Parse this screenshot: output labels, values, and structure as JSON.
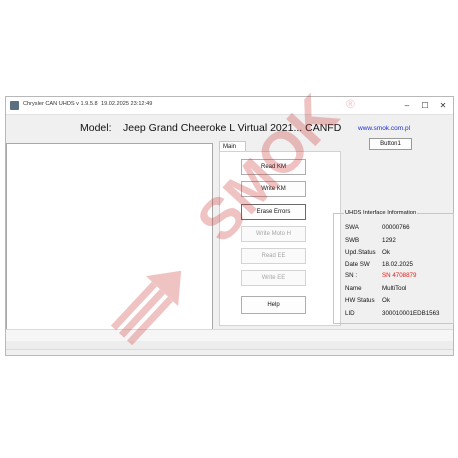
{
  "window": {
    "title": "Chrysler CAN UHDS v 1.9.5.8",
    "timestamp": "19.02.2025 23:12:49",
    "controls": [
      "–",
      "☐",
      "✕"
    ]
  },
  "header": {
    "model_label": "Model:",
    "model_value": "Jeep Grand Cheeroke L Virtual 2021... CANFD",
    "website": "www.smok.com.pl",
    "button1_label": "Button1"
  },
  "tabs": [
    {
      "label": "Main"
    }
  ],
  "buttons": [
    {
      "label": "Read KM",
      "enabled": true
    },
    {
      "label": "Write KM",
      "enabled": true
    },
    {
      "label": "Erase Errors",
      "enabled": true
    },
    {
      "label": "Write Moto H",
      "enabled": false
    },
    {
      "label": "Read EE",
      "enabled": false
    },
    {
      "label": "Write EE",
      "enabled": false
    },
    {
      "label": "Help",
      "enabled": true
    }
  ],
  "info": {
    "title": "UHDS Interface Information",
    "rows": [
      {
        "key": "SWA",
        "value": "00000766"
      },
      {
        "key": "SWB",
        "value": "1292"
      },
      {
        "key": "Upd.Status",
        "value": "Ok"
      },
      {
        "key": "Date  SW",
        "value": "18.02.2025"
      },
      {
        "key": "SN :",
        "value": "SN 4708879",
        "color": "#e01b1b"
      },
      {
        "key": "Name",
        "value": "MultiTool"
      },
      {
        "key": "HW Status",
        "value": "Ok"
      },
      {
        "key": "LID",
        "value": "300010001EDB1563"
      }
    ]
  },
  "watermark": {
    "text": "SMOK",
    "symbol": "®",
    "color": "#cc2b2b"
  }
}
